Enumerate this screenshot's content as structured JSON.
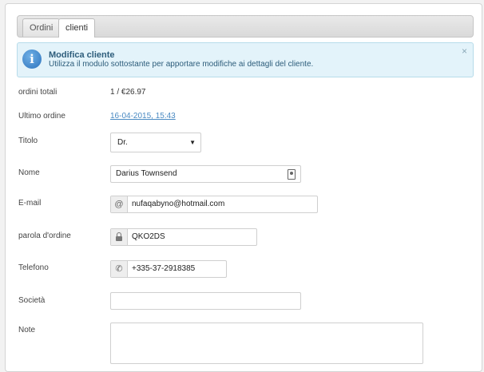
{
  "tabs": [
    {
      "label": "Ordini"
    },
    {
      "label": "clienti"
    }
  ],
  "alert": {
    "title": "Modifica cliente",
    "text": "Utilizza il modulo sottostante per apportare modifiche ai dettagli del cliente.",
    "close": "×"
  },
  "form": {
    "total_orders": {
      "label": "ordini totali",
      "value": "1 / €26.97"
    },
    "last_order": {
      "label": "Ultimo ordine",
      "value": "16-04-2015, 15:43"
    },
    "title": {
      "label": "Titolo",
      "value": "Dr."
    },
    "name": {
      "label": "Nome",
      "value": "Darius Townsend"
    },
    "email": {
      "label": "E-mail",
      "value": "nufaqabyno@hotmail.com"
    },
    "order_password": {
      "label": "parola d'ordine",
      "value": "QKO2DS"
    },
    "phone": {
      "label": "Telefono",
      "value": "+335-37-2918385"
    },
    "company": {
      "label": "Società",
      "value": ""
    },
    "note": {
      "label": "Note",
      "value": ""
    }
  }
}
